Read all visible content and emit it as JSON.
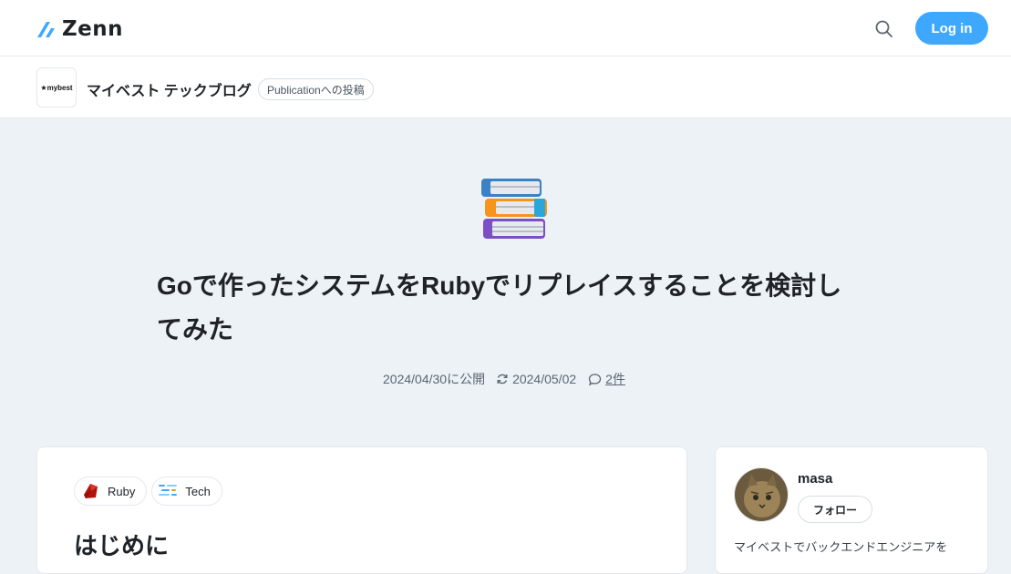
{
  "header": {
    "logo_text": "Zenn",
    "login_label": "Log in",
    "brand_color": "#3ea8ff"
  },
  "publication": {
    "logo_text": "★mybest",
    "name": "マイベスト テックブログ",
    "badge": "Publicationへの投稿"
  },
  "article": {
    "emoji": "books",
    "title_line1": "Goで作ったシステムをRubyでリプレイスすることを検討し",
    "title_line2": "てみた",
    "published": "2024/04/30に公開",
    "updated": "2024/05/02",
    "comments": "2件",
    "tags": [
      {
        "label": "Ruby",
        "icon": "ruby-icon"
      },
      {
        "label": "Tech",
        "icon": "tech-icon"
      }
    ],
    "first_heading": "はじめに"
  },
  "author": {
    "name": "masa",
    "follow_label": "フォロー",
    "bio": "マイベストでバックエンドエンジニアを"
  }
}
